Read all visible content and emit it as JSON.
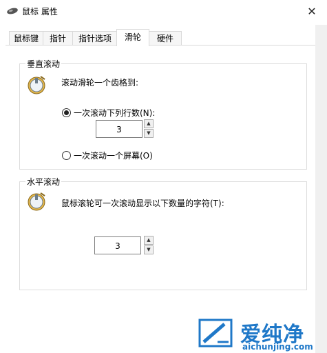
{
  "window": {
    "title": "鼠标 属性",
    "close_glyph": "✕"
  },
  "tabs": [
    {
      "label": "鼠标键",
      "active": false
    },
    {
      "label": "指针",
      "active": false
    },
    {
      "label": "指针选项",
      "active": false
    },
    {
      "label": "滑轮",
      "active": true
    },
    {
      "label": "硬件",
      "active": false
    }
  ],
  "vertical": {
    "group_label": "垂直滚动",
    "intro": "滚动滑轮一个齿格到:",
    "option_lines": {
      "label": "一次滚动下列行数(N):",
      "checked": true
    },
    "lines_value": "3",
    "option_screen": {
      "label": "一次滚动一个屏幕(O)",
      "checked": false
    },
    "icon": "mouse-wheel-icon"
  },
  "horizontal": {
    "group_label": "水平滚动",
    "intro": "鼠标滚轮可一次滚动显示以下数量的字符(T):",
    "chars_value": "3",
    "icon": "mouse-wheel-icon"
  },
  "watermark": {
    "brand": "爱纯净",
    "url": "aichunjing.com"
  },
  "colors": {
    "accent": "#1f78c8",
    "border": "#dcdcdc"
  }
}
